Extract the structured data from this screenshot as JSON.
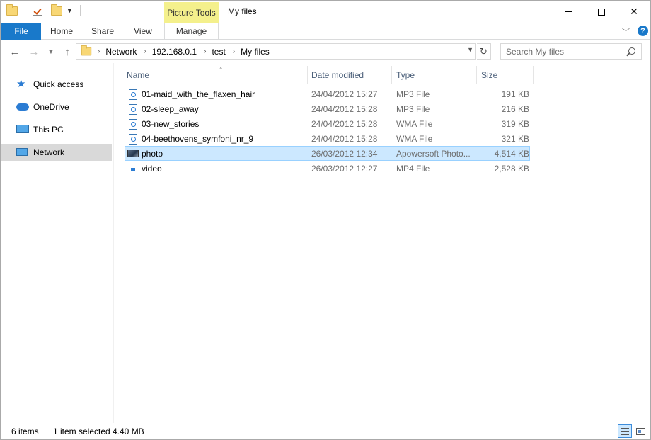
{
  "window": {
    "title": "My files",
    "contextual_tab_group": "Picture Tools"
  },
  "ribbon": {
    "tabs": [
      "File",
      "Home",
      "Share",
      "View",
      "Manage"
    ]
  },
  "address": {
    "breadcrumbs": [
      "Network",
      "192.168.0.1",
      "test",
      "My files"
    ]
  },
  "search": {
    "placeholder": "Search My files"
  },
  "nav_pane": {
    "items": [
      {
        "label": "Quick access",
        "icon": "star-icon"
      },
      {
        "label": "OneDrive",
        "icon": "cloud-icon"
      },
      {
        "label": "This PC",
        "icon": "computer-icon"
      },
      {
        "label": "Network",
        "icon": "network-icon",
        "selected": true
      }
    ]
  },
  "file_list": {
    "columns": [
      "Name",
      "Date modified",
      "Type",
      "Size"
    ],
    "rows": [
      {
        "name": "01-maid_with_the_flaxen_hair",
        "date": "24/04/2012 15:27",
        "type": "MP3 File",
        "size": "191 KB",
        "icon": "audio-file-icon"
      },
      {
        "name": "02-sleep_away",
        "date": "24/04/2012 15:28",
        "type": "MP3 File",
        "size": "216 KB",
        "icon": "audio-file-icon"
      },
      {
        "name": "03-new_stories",
        "date": "24/04/2012 15:28",
        "type": "WMA File",
        "size": "319 KB",
        "icon": "audio-file-icon"
      },
      {
        "name": "04-beethovens_symfoni_nr_9",
        "date": "24/04/2012 15:28",
        "type": "WMA File",
        "size": "321 KB",
        "icon": "audio-file-icon"
      },
      {
        "name": "photo",
        "date": "26/03/2012 12:34",
        "type": "Apowersoft Photo...",
        "size": "4,514 KB",
        "icon": "image-file-icon",
        "selected": true
      },
      {
        "name": "video",
        "date": "26/03/2012 12:27",
        "type": "MP4 File",
        "size": "2,528 KB",
        "icon": "video-file-icon"
      }
    ]
  },
  "status_bar": {
    "item_count": "6 items",
    "selection": "1 item selected",
    "selection_size": "4.40 MB"
  },
  "colors": {
    "file_tab": "#1979ca",
    "contextual_tab": "#f4f08c",
    "selection_bg": "#cce8ff",
    "selection_border": "#99d1ff",
    "nav_selected_bg": "#d9d9d9",
    "column_header_text": "#4c607a"
  }
}
